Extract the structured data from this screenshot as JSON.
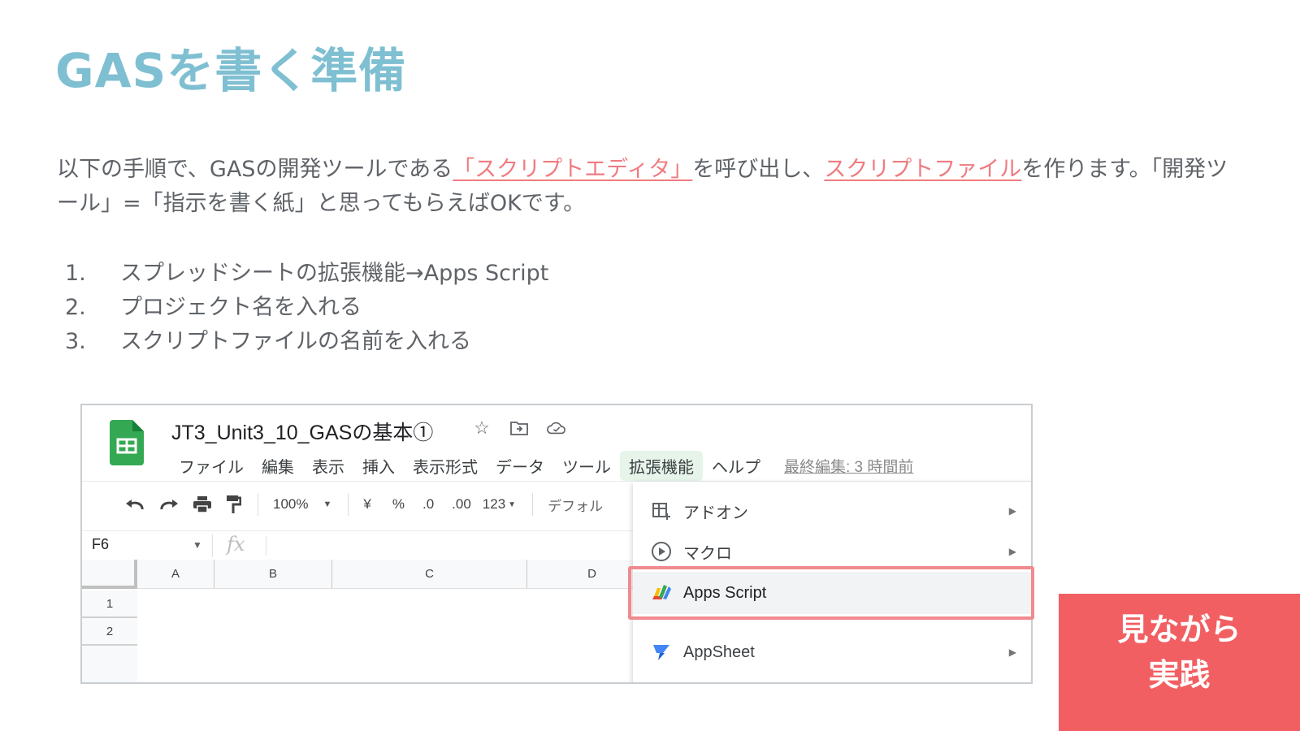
{
  "slide": {
    "title": "GASを書く準備",
    "intro": {
      "part1": "以下の手順で、GASの開発ツールである",
      "link1": "「スクリプトエディタ」",
      "part2": "を呼び出し、",
      "link2": "スクリプトファイル",
      "part3": "を作ります。「開発ツール」=「指示を書く紙」と思ってもらえばOKです。"
    },
    "steps": [
      {
        "num": "1.",
        "text": "スプレッドシートの拡張機能→Apps Script"
      },
      {
        "num": "2.",
        "text": "プロジェクト名を入れる"
      },
      {
        "num": "3.",
        "text": "スクリプトファイルの名前を入れる"
      }
    ],
    "badge": {
      "line1": "見ながら",
      "line2": "実践"
    },
    "colors": {
      "title": "#7fbfd2",
      "link": "#ef7b80",
      "badge": "#f25f62",
      "highlight": "#f08a8f"
    }
  },
  "sheet": {
    "doc_title": "JT3_Unit3_10_GASの基本①",
    "title_icons": [
      "star-icon",
      "move-to-folder-icon",
      "cloud-saved-icon"
    ],
    "menu": [
      "ファイル",
      "編集",
      "表示",
      "挿入",
      "表示形式",
      "データ",
      "ツール",
      "拡張機能",
      "ヘルプ"
    ],
    "active_menu": "拡張機能",
    "last_edit": "最終編集: 3 時間前",
    "toolbar": {
      "zoom": "100%",
      "currency": "¥",
      "percent": "%",
      "decrease_decimal": ".0",
      "increase_decimal": ".00",
      "number_format": "123",
      "font": "デフォル"
    },
    "name_box": "F6",
    "fx": "fx",
    "columns": [
      "A",
      "B",
      "C",
      "D"
    ],
    "rows": [
      "1",
      "2"
    ],
    "extensions_menu": [
      {
        "label": "アドオン",
        "icon": "add-on-icon",
        "submenu": true
      },
      {
        "label": "マクロ",
        "icon": "macro-play-icon",
        "submenu": true
      },
      {
        "label": "Apps Script",
        "icon": "apps-script-icon",
        "submenu": false,
        "highlighted": true
      },
      {
        "label": "AppSheet",
        "icon": "appsheet-icon",
        "submenu": true
      }
    ]
  }
}
